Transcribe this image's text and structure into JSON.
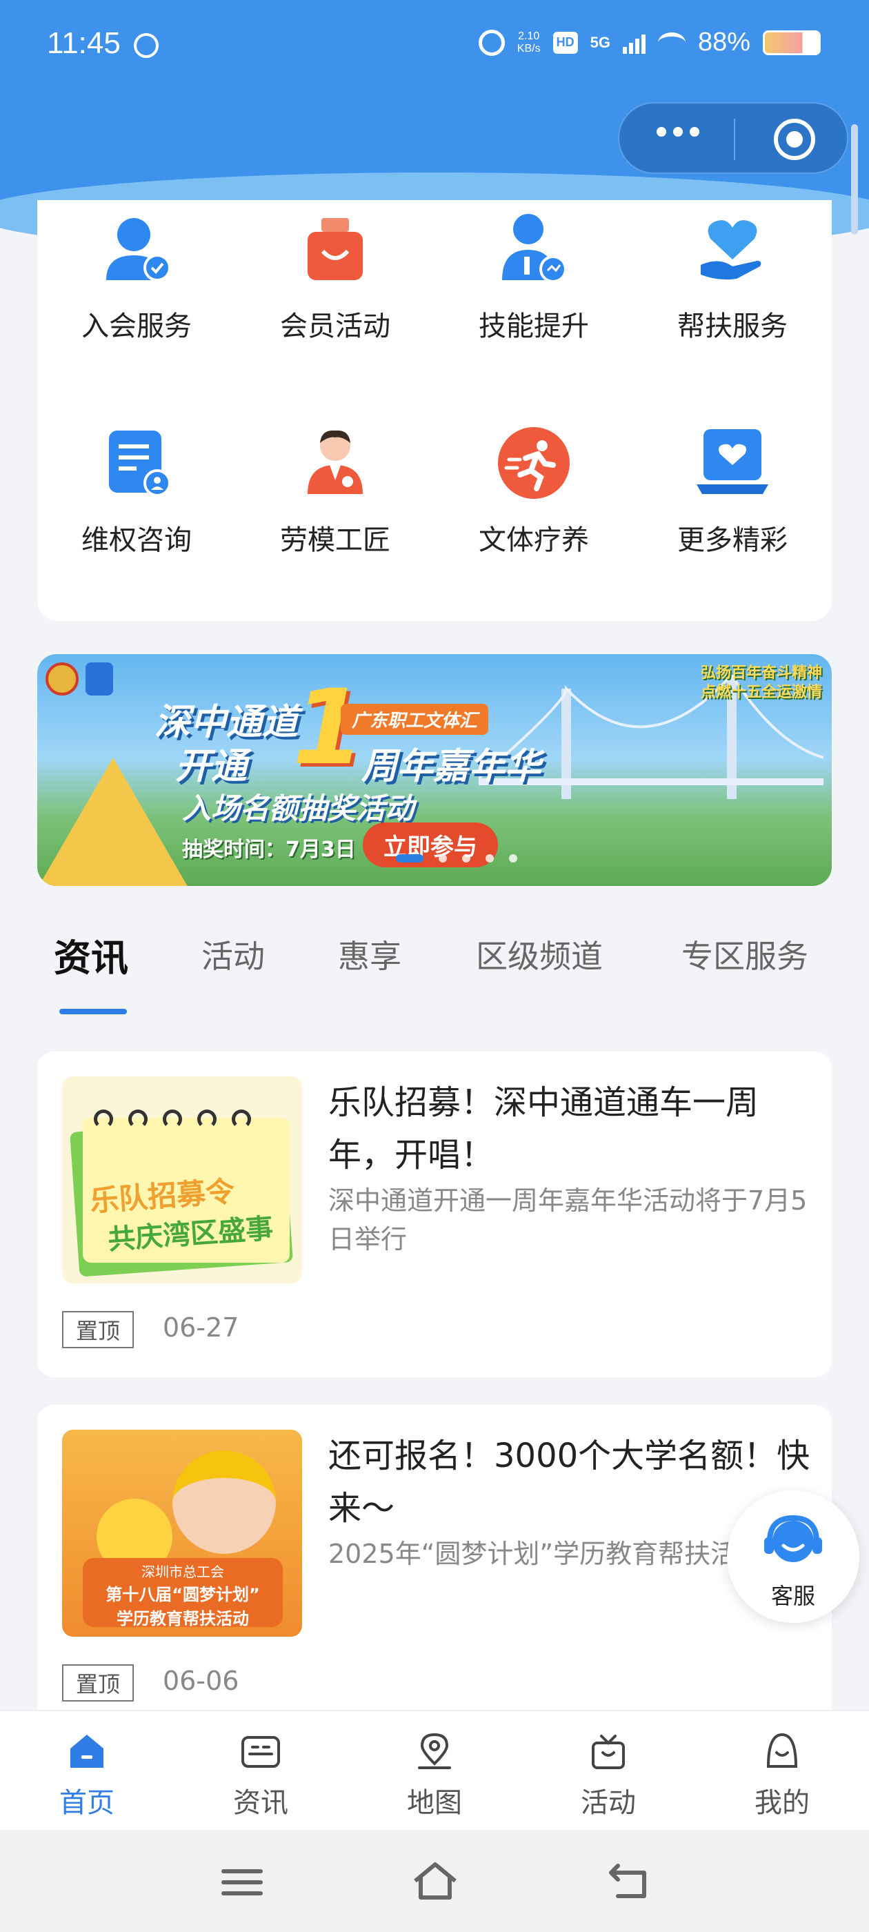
{
  "status_bar": {
    "time": "11:45",
    "speed_value": "2.10",
    "speed_unit": "KB/s",
    "hd": "HD",
    "network": "5G",
    "battery": "88%"
  },
  "services": [
    {
      "label": "入会服务",
      "icon": "member-join-icon"
    },
    {
      "label": "会员活动",
      "icon": "gift-bag-icon"
    },
    {
      "label": "技能提升",
      "icon": "skill-user-icon"
    },
    {
      "label": "帮扶服务",
      "icon": "heart-hand-icon"
    },
    {
      "label": "维权咨询",
      "icon": "document-user-icon"
    },
    {
      "label": "劳模工匠",
      "icon": "model-worker-icon"
    },
    {
      "label": "文体疗养",
      "icon": "running-icon"
    },
    {
      "label": "更多精彩",
      "icon": "more-heart-icon"
    }
  ],
  "banner": {
    "title_line1": "深中通道",
    "title_line2": "开通",
    "big_number": "1",
    "title_line3": "周年嘉年华",
    "tag": "广东职工文体汇",
    "subtitle": "入场名额抽奖活动",
    "time_text": "抽奖时间：7月3日",
    "cta": "立即参与",
    "corner_line1": "弘扬百年奋斗精神",
    "corner_line2": "点燃十五全运激情"
  },
  "tabs": [
    "资讯",
    "活动",
    "惠享",
    "区级频道",
    "专区服务"
  ],
  "news": [
    {
      "title": "乐队招募！深中通道通车一周年，开唱！",
      "desc": "深中通道开通一周年嘉年华活动将于7月5日举行",
      "badge": "置顶",
      "date": "06-27",
      "thumb_line1": "乐队招募令",
      "thumb_line2": "共庆湾区盛事"
    },
    {
      "title": "还可报名！3000个大学名额！快来～",
      "desc": "2025年“圆梦计划”学历教育帮扶活动",
      "badge": "置顶",
      "date": "06-06",
      "thumb_line1": "深圳市总工会",
      "thumb_line2": "第十八届“圆梦计划”",
      "thumb_line3": "学历教育帮扶活动"
    }
  ],
  "float_service": {
    "label": "客服"
  },
  "nav": [
    {
      "label": "首页",
      "icon": "home-icon",
      "active": true
    },
    {
      "label": "资讯",
      "icon": "news-icon",
      "active": false
    },
    {
      "label": "地图",
      "icon": "map-pin-icon",
      "active": false
    },
    {
      "label": "活动",
      "icon": "activity-gift-icon",
      "active": false
    },
    {
      "label": "我的",
      "icon": "profile-icon",
      "active": false
    }
  ],
  "colors": {
    "primary": "#2f7ee6",
    "header": "#3e92ec",
    "icon_blue": "#2e88ef",
    "icon_orange": "#f05a3c"
  }
}
